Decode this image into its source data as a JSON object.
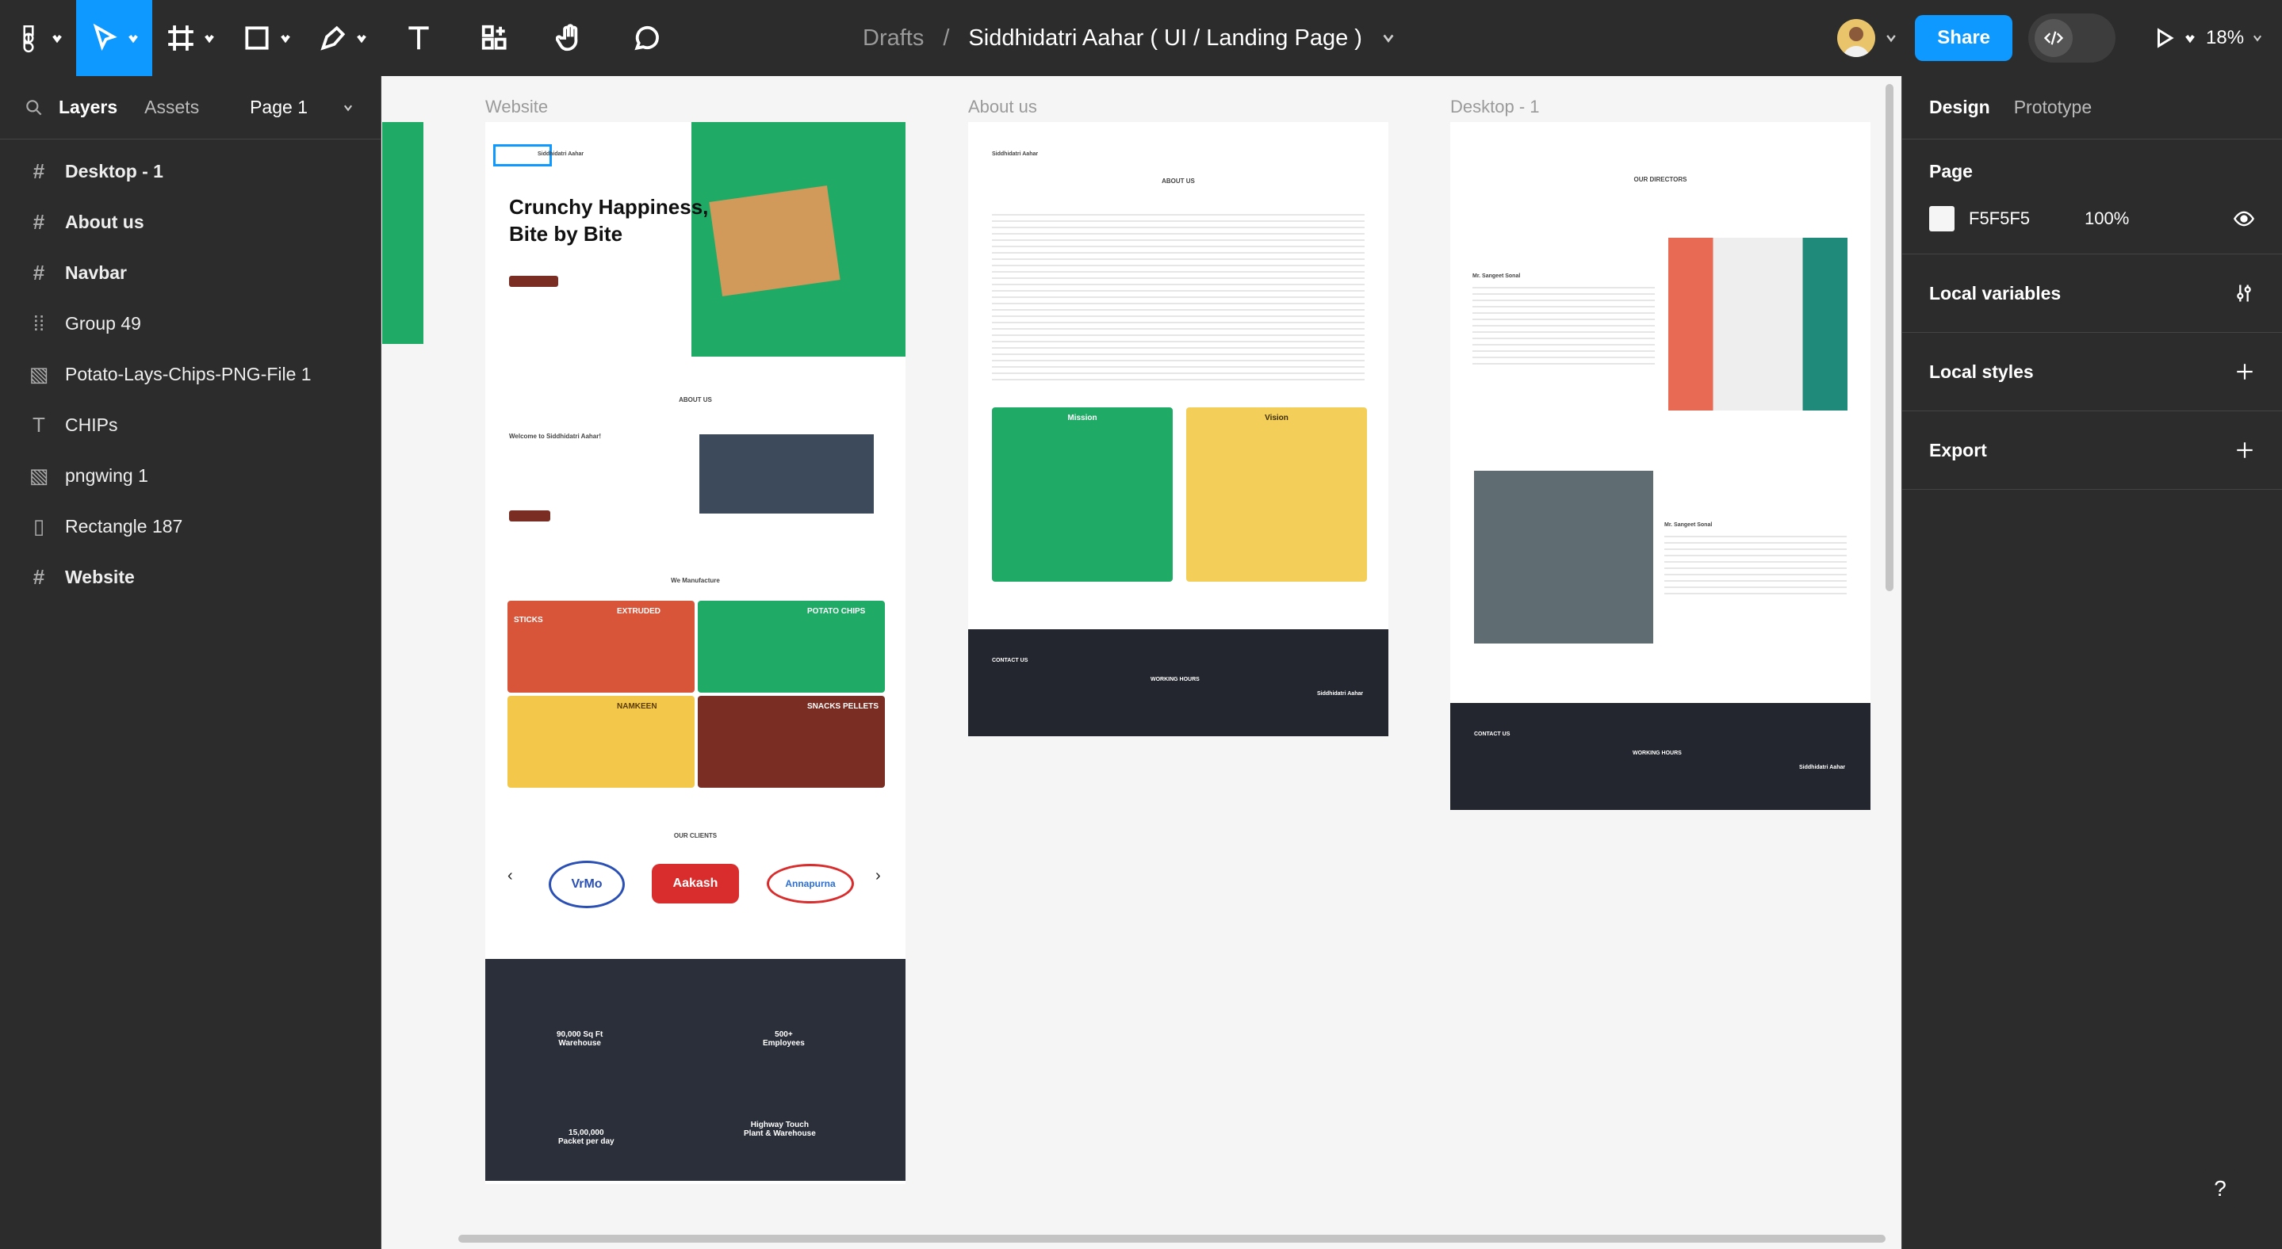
{
  "toolbar": {
    "breadcrumb_root": "Drafts",
    "breadcrumb_sep": "/",
    "file_name": "Siddhidatri Aahar ( UI / Landing Page )",
    "share_label": "Share",
    "zoom": "18%"
  },
  "left_panel": {
    "tab_layers": "Layers",
    "tab_assets": "Assets",
    "page_selector": "Page 1",
    "layers": [
      {
        "label": "Desktop - 1",
        "icon": "frame-icon"
      },
      {
        "label": "About us",
        "icon": "frame-icon"
      },
      {
        "label": "Navbar",
        "icon": "frame-icon"
      },
      {
        "label": "Group 49",
        "icon": "group-icon"
      },
      {
        "label": "Potato-Lays-Chips-PNG-File 1",
        "icon": "image-icon"
      },
      {
        "label": "CHIPs",
        "icon": "text-icon"
      },
      {
        "label": "pngwing 1",
        "icon": "image-icon"
      },
      {
        "label": "Rectangle 187",
        "icon": "rectangle-icon"
      },
      {
        "label": "Website",
        "icon": "frame-icon"
      }
    ]
  },
  "right_panel": {
    "tab_design": "Design",
    "tab_prototype": "Prototype",
    "page_heading": "Page",
    "page_color": "F5F5F5",
    "page_opacity": "100%",
    "local_variables": "Local variables",
    "local_styles": "Local styles",
    "export": "Export"
  },
  "canvas": {
    "frame_website": "Website",
    "frame_about": "About us",
    "frame_desktop": "Desktop - 1",
    "website": {
      "brand": "Siddhidatri Aahar",
      "hero_title_1": "Crunchy Happiness,",
      "hero_title_2": "Bite by Bite",
      "about_heading": "ABOUT US",
      "welcome": "Welcome to Siddhidatri Aahar!",
      "manufacture_heading": "We Manufacture",
      "products": [
        "EXTRUDED STICKS",
        "POTATO CHIPS",
        "NAMKEEN",
        "SNACKS PELLETS"
      ],
      "clients_heading": "OUR CLIENTS",
      "clients": [
        "VrMo",
        "Aakash",
        "Annapurna"
      ],
      "stats": [
        {
          "value": "90,000 Sq Ft",
          "label": "Warehouse"
        },
        {
          "value": "500+",
          "label": "Employees"
        },
        {
          "value": "15,00,000",
          "label": "Packet per day"
        },
        {
          "value": "Highway Touch",
          "label": "Plant & Warehouse"
        }
      ]
    },
    "about": {
      "heading": "ABOUT US",
      "mission": "Mission",
      "vision": "Vision",
      "contact": "CONTACT US",
      "hours": "WORKING HOURS",
      "brand": "Siddhidatri Aahar"
    },
    "desktop": {
      "heading": "OUR DIRECTORS",
      "director1": "Mr. Sangeet Sonal",
      "director2": "Mr. Sangeet Sonal",
      "contact": "CONTACT US",
      "hours": "WORKING HOURS",
      "brand": "Siddhidatri Aahar"
    }
  },
  "help_label": "?"
}
